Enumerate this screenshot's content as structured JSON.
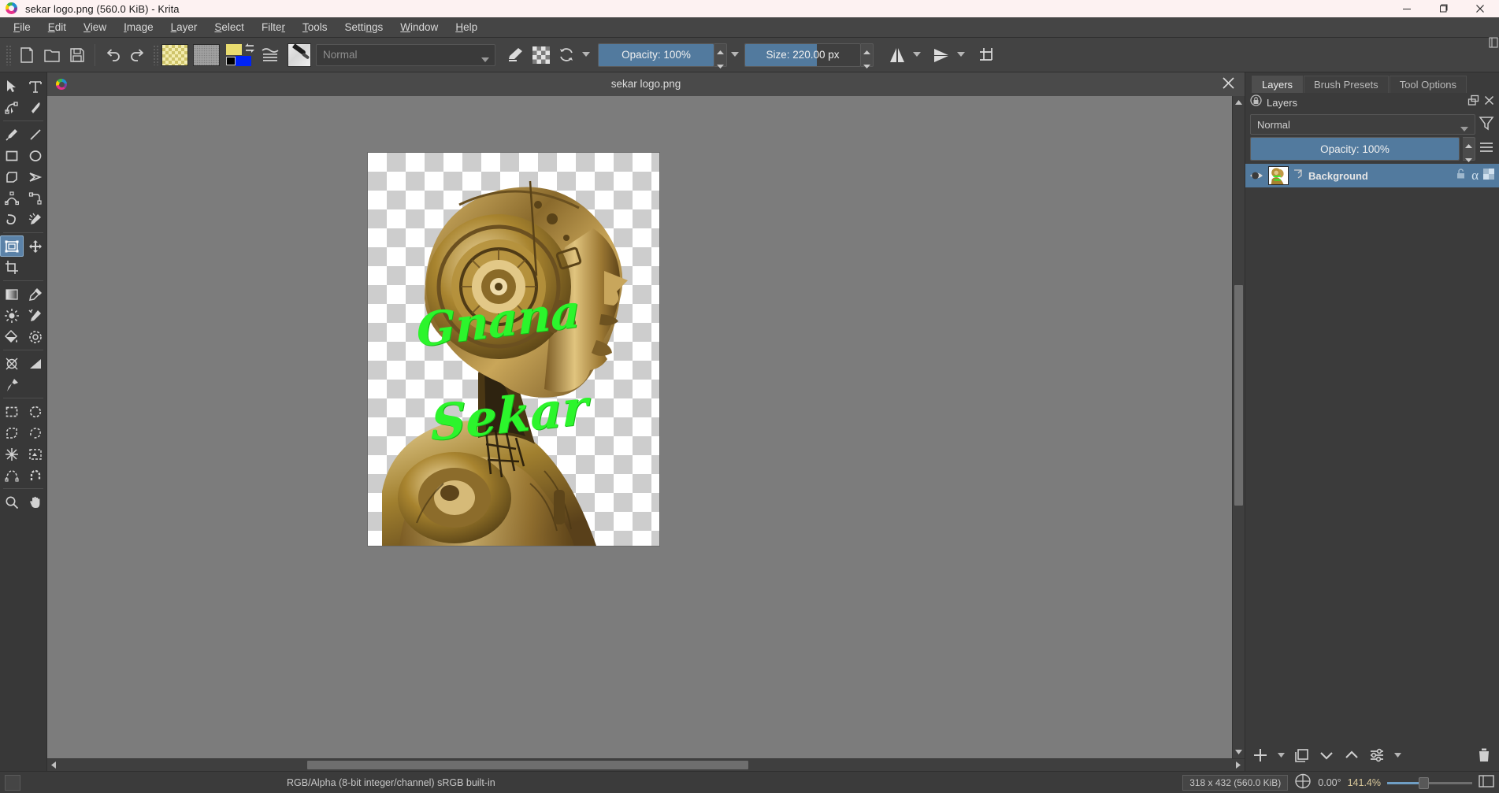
{
  "window": {
    "title": "sekar logo.png (560.0 KiB)  - Krita",
    "minimize_label": "Minimize",
    "maximize_label": "Restore",
    "close_label": "Close"
  },
  "menubar": {
    "items": [
      {
        "label": "File",
        "accel": "F"
      },
      {
        "label": "Edit",
        "accel": "E"
      },
      {
        "label": "View",
        "accel": "V"
      },
      {
        "label": "Image",
        "accel": "I"
      },
      {
        "label": "Layer",
        "accel": "L"
      },
      {
        "label": "Select",
        "accel": "S"
      },
      {
        "label": "Filter",
        "accel": "r"
      },
      {
        "label": "Tools",
        "accel": "T"
      },
      {
        "label": "Settings",
        "accel": "n"
      },
      {
        "label": "Window",
        "accel": "W"
      },
      {
        "label": "Help",
        "accel": "H"
      }
    ]
  },
  "toolbar": {
    "new_label": "New",
    "open_label": "Open",
    "save_label": "Save",
    "undo_label": "Undo",
    "redo_label": "Redo",
    "gradient_label": "Gradients",
    "pattern_label": "Patterns",
    "fgbg_label": "Foreground and background colors",
    "presets_label": "Brush presets",
    "brush_thumb_label": "Current brush preset",
    "blend_mode": "Normal",
    "eraser_label": "Eraser mode",
    "preserve_alpha_label": "Preserve alpha",
    "reload_label": "Reload preset",
    "opacity": "Opacity:  100%",
    "opacity_percent": 100,
    "size": "Size:  220.00 px",
    "size_percent": 62,
    "mirror_h_label": "Horizontal mirror tool",
    "mirror_v_label": "Vertical mirror tool",
    "wrap_label": "Wrap around mode"
  },
  "toolbox": {
    "tools": [
      {
        "name": "select-shapes-tool",
        "label": "Select Shapes Tool"
      },
      {
        "name": "text-tool",
        "label": "Text Tool"
      },
      {
        "name": "edit-shapes-tool",
        "label": "Edit Shapes Tool"
      },
      {
        "name": "calligraphy-tool",
        "label": "Calligraphy"
      },
      {
        "name": "freehand-brush-tool",
        "label": "Freehand Brush Tool"
      },
      {
        "name": "line-tool",
        "label": "Line Tool"
      },
      {
        "name": "rectangle-tool",
        "label": "Rectangle Tool"
      },
      {
        "name": "ellipse-tool",
        "label": "Ellipse Tool"
      },
      {
        "name": "polygon-tool",
        "label": "Polygon Tool"
      },
      {
        "name": "polyline-tool",
        "label": "Polyline Tool"
      },
      {
        "name": "bezier-curve-tool",
        "label": "Bezier Curve Tool"
      },
      {
        "name": "freehand-path-tool",
        "label": "Freehand Path Tool"
      },
      {
        "name": "dynamic-brush-tool",
        "label": "Dynamic Brush Tool"
      },
      {
        "name": "multibrush-tool",
        "label": "Multibrush Tool"
      },
      {
        "name": "transform-tool",
        "label": "Transform a layer or a selection",
        "active": true
      },
      {
        "name": "move-tool",
        "label": "Move a layer"
      },
      {
        "name": "crop-tool",
        "label": "Crop the image to an area"
      },
      {
        "name": "gradient-tool",
        "label": "Draw a gradient"
      },
      {
        "name": "color-sampler-tool",
        "label": "Select a color from the image"
      },
      {
        "name": "colorize-mask-tool",
        "label": "Colorize Mask Tool"
      },
      {
        "name": "smart-patch-tool",
        "label": "Smart Patch Tool"
      },
      {
        "name": "fill-tool",
        "label": "Fill a contiguous area"
      },
      {
        "name": "enclose-and-fill-tool",
        "label": "Enclose and Fill Tool"
      },
      {
        "name": "assistant-tool",
        "label": "Assistant Tool"
      },
      {
        "name": "measure-tool",
        "label": "Measure the distance between two points"
      },
      {
        "name": "reference-images-tool",
        "label": "Reference Images Tool"
      },
      {
        "name": "rectangular-selection-tool",
        "label": "Rectangular Selection"
      },
      {
        "name": "elliptical-selection-tool",
        "label": "Elliptical Selection"
      },
      {
        "name": "polygonal-selection-tool",
        "label": "Polygonal Selection"
      },
      {
        "name": "freehand-selection-tool",
        "label": "Freehand Selection"
      },
      {
        "name": "contiguous-selection-tool",
        "label": "Contiguous Selection"
      },
      {
        "name": "similar-color-selection-tool",
        "label": "Similar Color Selection"
      },
      {
        "name": "bezier-selection-tool",
        "label": "Bezier Curve Selection"
      },
      {
        "name": "magnetic-selection-tool",
        "label": "Magnetic Selection"
      },
      {
        "name": "zoom-tool",
        "label": "Zoom Tool"
      },
      {
        "name": "pan-tool",
        "label": "Pan Tool"
      }
    ]
  },
  "document": {
    "tab_title": "sekar logo.png",
    "close_label": "Close tab",
    "artwork": {
      "text_line_1": "Gnana",
      "text_line_2": "Sekar",
      "text_color": "#2cf52c",
      "subject": "gold robot head profile"
    }
  },
  "docker": {
    "tabs": [
      {
        "label": "Layers",
        "active": true
      },
      {
        "label": "Brush Presets",
        "active": false
      },
      {
        "label": "Tool Options",
        "active": false
      }
    ],
    "title": "Layers",
    "float_label": "Float Docker",
    "close_label": "Close Docker",
    "blend_mode": "Normal",
    "opacity": "Opacity:  100%",
    "opacity_percent": 100,
    "filter_label": "Filter layers",
    "menu_label": "Layer options menu",
    "layers": [
      {
        "name": "Background",
        "visible": true,
        "locked": false,
        "alpha_label": "α",
        "selected": true
      }
    ],
    "buttons": [
      {
        "name": "add-layer-button",
        "label": "Add layer"
      },
      {
        "name": "duplicate-layer-button",
        "label": "Duplicate layer"
      },
      {
        "name": "move-layer-down-button",
        "label": "Move layer down"
      },
      {
        "name": "move-layer-up-button",
        "label": "Move layer up"
      },
      {
        "name": "layer-properties-button",
        "label": "Layer properties"
      },
      {
        "name": "delete-layer-button",
        "label": "Delete layer"
      }
    ]
  },
  "statusbar": {
    "color_space": "RGB/Alpha (8-bit integer/channel)   sRGB built-in",
    "image_size": "318 x 432 (560.0 KiB)",
    "rotation": "0.00°",
    "zoom": "141.4%",
    "zoom_percent": 40,
    "selection_icon_label": "selection-mask-indicator"
  }
}
